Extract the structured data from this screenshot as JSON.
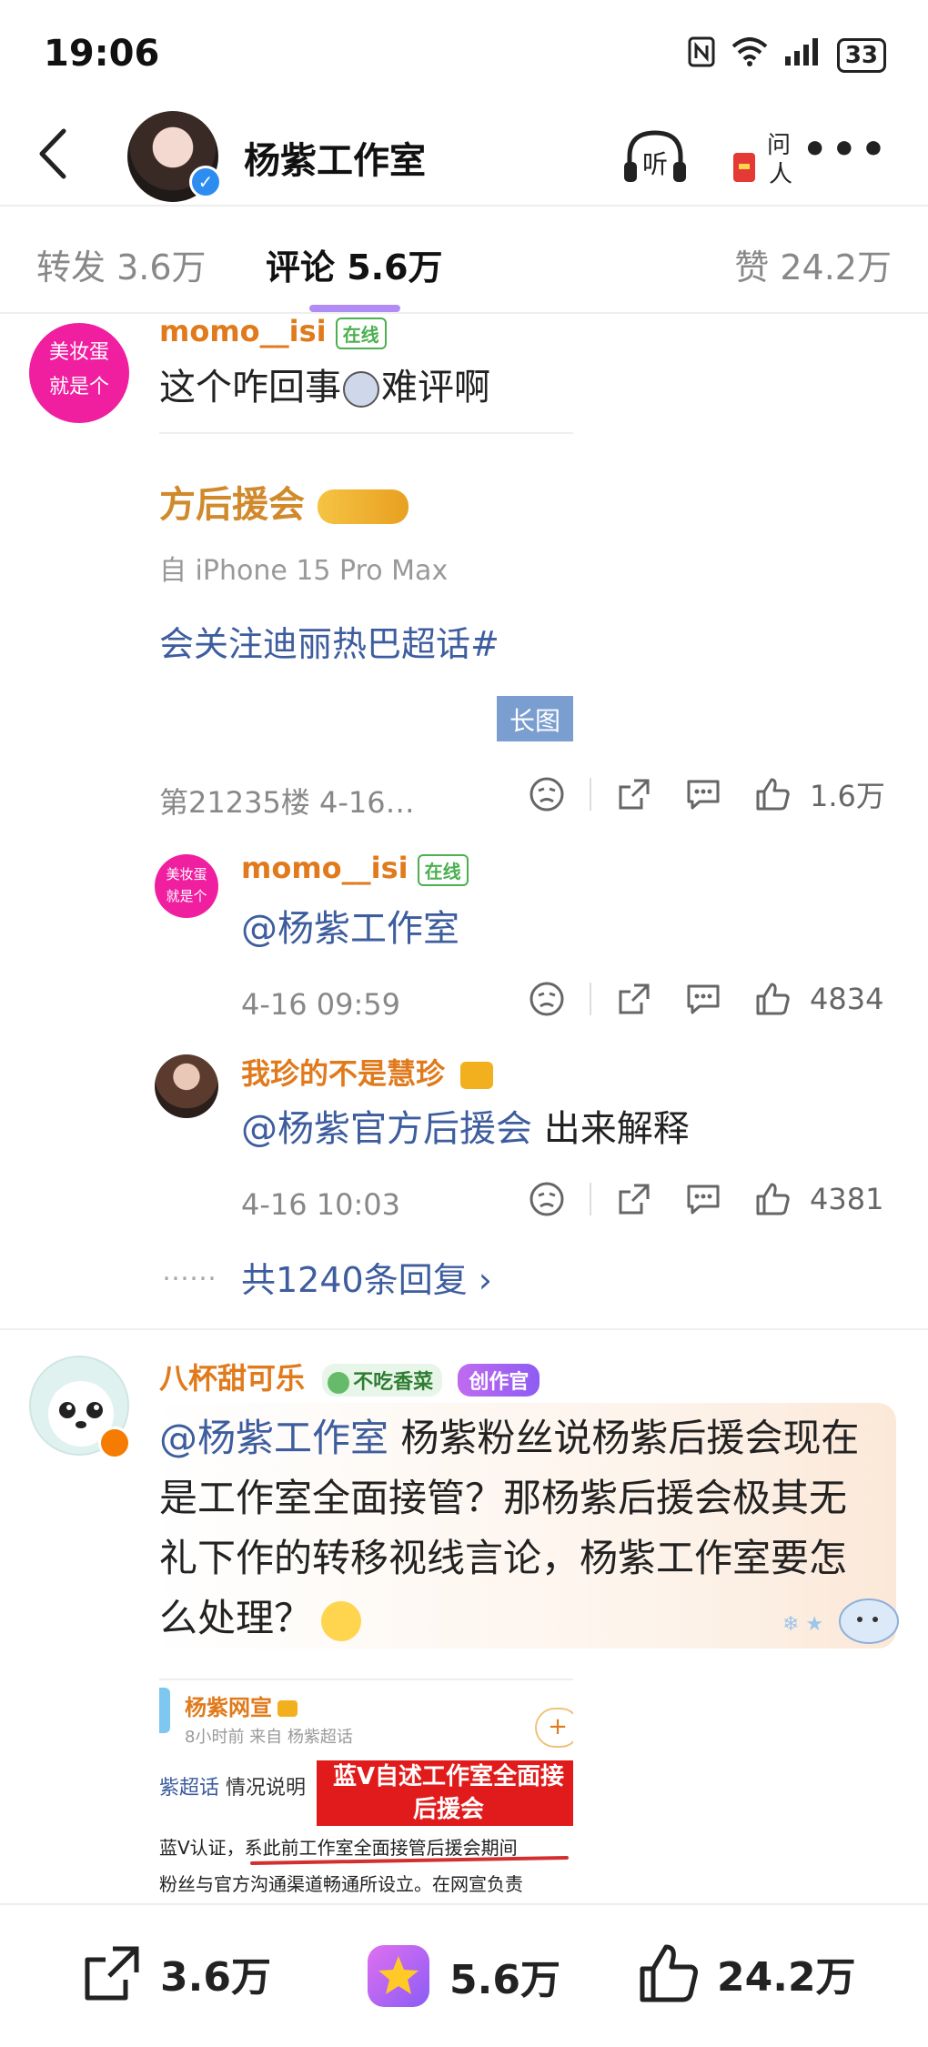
{
  "status": {
    "time": "19:06",
    "battery": "33"
  },
  "header": {
    "title": "杨紫工作室",
    "listen_label": "听",
    "ask_label": "问人"
  },
  "tabs": [
    {
      "label": "转发 3.6万"
    },
    {
      "label": "评论 5.6万"
    },
    {
      "label": "赞 24.2万"
    }
  ],
  "comment1": {
    "avatar_text": "美妆蛋就是个",
    "username": "momo__isi",
    "online": "在线",
    "text_before": "这个咋回事",
    "text_after": "难评啊",
    "image_lines": [
      "方后援会",
      "自 iPhone 15 Pro Max",
      "会关注迪丽热巴超话#"
    ],
    "image_tag": "长图",
    "floor": "第21235楼 4-16…",
    "likes": "1.6万"
  },
  "reply1": {
    "avatar_text": "美妆蛋就是个",
    "username": "momo__isi",
    "online": "在线",
    "mention": "@杨紫工作室",
    "time": "4-16 09:59",
    "likes": "4834"
  },
  "reply2": {
    "username": "我珍的不是慧珍",
    "mention": "@杨紫官方后援会",
    "text": " 出来解释",
    "time": "4-16 10:03",
    "likes": "4381"
  },
  "replies_more": {
    "dots": "……",
    "label": "共1240条回复 ›"
  },
  "comment2": {
    "username": "八杯甜可乐",
    "badge1": "不吃香菜",
    "badge2": "创作官",
    "mention": "@杨紫工作室",
    "text": " 杨紫粉丝说杨紫后援会现在是工作室全面接管？那杨紫后援会极其无礼下作的转移视线言论，杨紫工作室要怎么处理？",
    "image": {
      "account": "杨紫网宣",
      "sub": "8小时前 来自 杨紫超话",
      "tag": "紫超话",
      "tag_after": " 情况说明",
      "banner": "蓝V自述工作室全面接后援会",
      "line1": "蓝V认证，系此前工作室全面接管后援会期间",
      "line2": "粉丝与官方沟通渠道畅通所设立。在网宣负责"
    }
  },
  "bottom": {
    "repost": "3.6万",
    "comment": "5.6万",
    "like": "24.2万"
  }
}
